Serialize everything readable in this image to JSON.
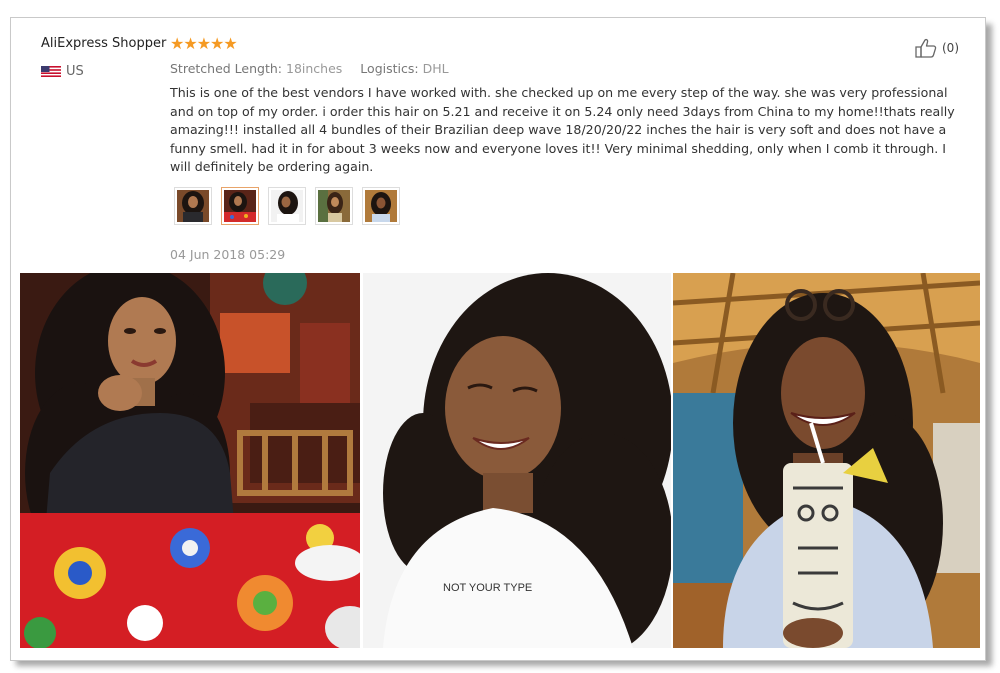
{
  "review": {
    "reviewer": "AliExpress Shopper",
    "stars": "★★★★★",
    "country": "US",
    "helpful_count": "(0)",
    "props": {
      "length_label": "Stretched Length:",
      "length_value": "18inches",
      "logistics_label": "Logistics:",
      "logistics_value": "DHL"
    },
    "text": "This is one of the best vendors I have worked with. she checked up on me every step of the way. she was very professional and on top of my order. i order this hair on 5.21 and receive it on 5.24 only need 3days from China to my home!!thats really amazing!!! installed all 4 bundles of their Brazilian deep wave 18/20/20/22 inches the hair is very soft and does not have a funny smell. had it in for about 3 weeks now and everyone loves it!! Very minimal shedding, only when I comb it through. I will definitely be ordering again.",
    "date": "04 Jun 2018 05:29",
    "shirt_text": "NOT YOUR TYPE"
  },
  "colors": {
    "star": "#f59a23",
    "text": "#333333",
    "muted": "#999999",
    "active_thumb_border": "#e8a46a"
  },
  "icons": [
    "us-flag-icon",
    "thumbs-up-icon"
  ]
}
